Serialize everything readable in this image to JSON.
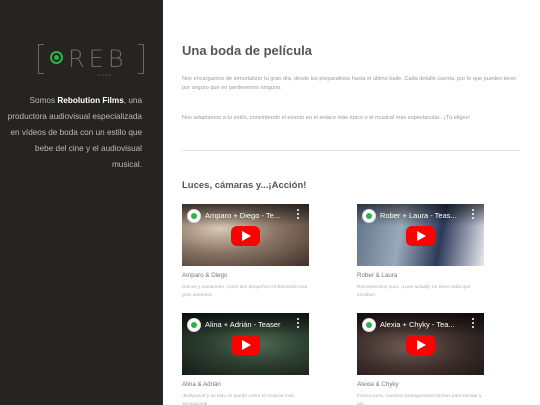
{
  "sidebar": {
    "logo_text": "REB",
    "logo_sub": "FILMS",
    "intro_prefix": "Somos ",
    "intro_brand": "Rebolution Films",
    "intro_suffix": ", una productora audiovisual especializada en vídeos de boda con un estilo que bebe del cine y el audiovisual musical."
  },
  "main": {
    "title": "Una boda de película",
    "paragraph1": "Nos encargamos de inmortalizar tu gran día, desde los preparativos hasta el último baile. Cada detalle cuenta, por lo que puedes tener por seguro que no perderemos ninguno.",
    "paragraph2": "Nos adaptamos a tu estilo, convirtiendo el evento en el enlace más épico o el musical más espectacular...¡Tú eliges!",
    "section_title": "Luces, cámaras y...¡Acción!"
  },
  "videos": [
    {
      "video_title": "Amparo + Diego - Te...",
      "caption": "Amparo & Diego",
      "description": "Dulces y cantarines, como dos pequeños embarcando una gran aventura."
    },
    {
      "video_title": "Rober + Laura - Teas...",
      "caption": "Rober & Laura",
      "description": "Romanticismo puro. ¡Love actually no tiene nada que envidiar!"
    },
    {
      "video_title": "Alina + Adrián - Teaser",
      "caption": "Alina & Adrián",
      "description": "¡Bollywood y su lado se quedó corto! El musical más sensacional"
    },
    {
      "video_title": "Alexia + Chyky - Tea...",
      "caption": "Alexia & Chyky",
      "description": "Fresca pura, nuestros protagonistas hechas para brindar y, por..."
    }
  ],
  "colors": {
    "sidebar_bg": "#262422",
    "accent_green": "#2db34a",
    "youtube_red": "#ff0000"
  },
  "icons": [
    "channel-avatar-icon",
    "kebab-menu-icon",
    "youtube-play-icon"
  ]
}
